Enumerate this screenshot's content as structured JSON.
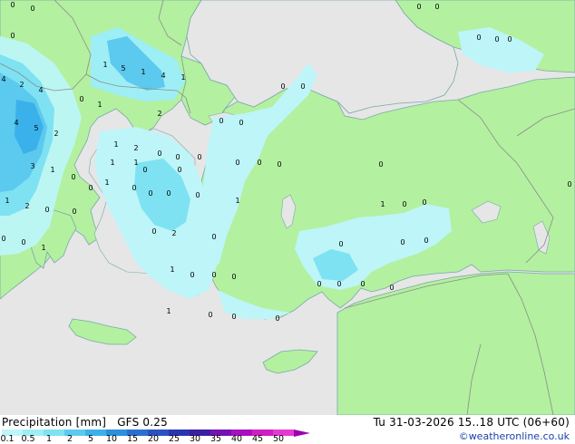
{
  "legend": {
    "title": "Precipitation [mm]",
    "model": "GFS 0.25",
    "valid_time": "Tu 31-03-2026 15..18 UTC (06+60)",
    "credit": "©weatheronline.co.uk",
    "ticks": [
      "0.1",
      "0.5",
      "1",
      "2",
      "5",
      "10",
      "15",
      "20",
      "25",
      "30",
      "35",
      "40",
      "45",
      "50"
    ],
    "colors": [
      "#bdf5f8",
      "#9eeef5",
      "#7ee2f2",
      "#5cc9ee",
      "#3ab1ea",
      "#2b8fdc",
      "#2a6fd0",
      "#2a52c2",
      "#2a34b0",
      "#3a1fa0",
      "#7412b4",
      "#a80fc0",
      "#d21cc4",
      "#e43ad2"
    ]
  },
  "map_colors": {
    "sea": "#e6e6e6",
    "land": "#b3f0a0",
    "border": "#8c8c8c",
    "coast": "#7aa8a8"
  },
  "station_values": [
    "0",
    "0",
    "0",
    "0",
    "0",
    "4",
    "2",
    "4",
    "1",
    "5",
    "1",
    "4",
    "1",
    "0",
    "1",
    "2",
    "4",
    "5",
    "2",
    "0",
    "0",
    "0",
    "3",
    "1",
    "0",
    "1",
    "2",
    "0",
    "0",
    "0",
    "1",
    "1",
    "0",
    "0",
    "0",
    "0",
    "0",
    "0",
    "0",
    "1",
    "0",
    "1",
    "2",
    "0",
    "0",
    "0",
    "0",
    "2",
    "1",
    "1",
    "0",
    "0",
    "0",
    "1",
    "0",
    "0",
    "0",
    "0",
    "0",
    "0",
    "1",
    "0",
    "0",
    "0",
    "0",
    "0",
    "0",
    "0",
    "0",
    "0",
    "0",
    "0",
    "0",
    "1",
    "0",
    "0",
    "0",
    "0",
    "1"
  ]
}
